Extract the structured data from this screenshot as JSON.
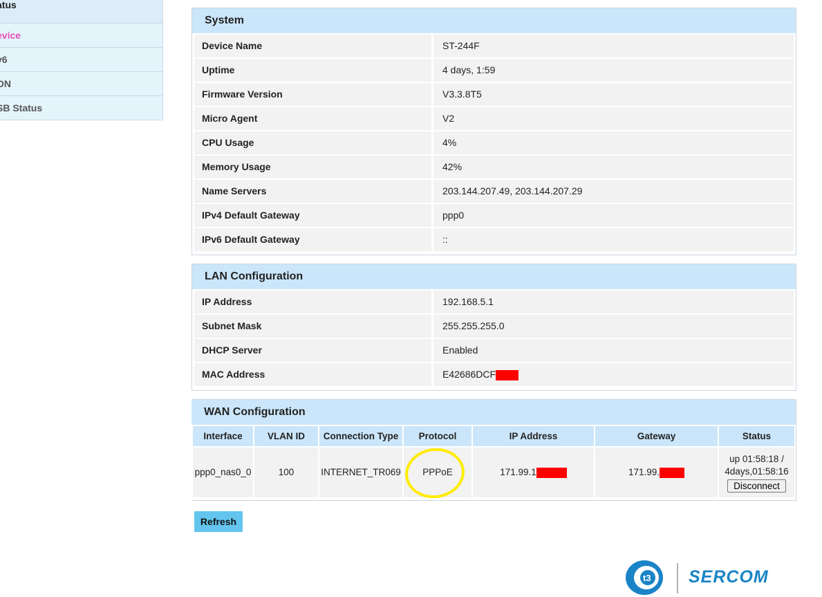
{
  "sidebar": {
    "header": "atus",
    "items": [
      {
        "label": "evice",
        "active": true
      },
      {
        "label": "v6",
        "active": false
      },
      {
        "label": "ON",
        "active": false
      },
      {
        "label": "SB Status",
        "active": false
      }
    ]
  },
  "system": {
    "title": "System",
    "rows": [
      {
        "key": "Device Name",
        "value": "ST-244F"
      },
      {
        "key": "Uptime",
        "value": "4 days, 1:59"
      },
      {
        "key": "Firmware Version",
        "value": "V3.3.8T5"
      },
      {
        "key": "Micro Agent",
        "value": "V2"
      },
      {
        "key": "CPU Usage",
        "value": "4%"
      },
      {
        "key": "Memory Usage",
        "value": "42%"
      },
      {
        "key": "Name Servers",
        "value": "203.144.207.49, 203.144.207.29"
      },
      {
        "key": "IPv4 Default Gateway",
        "value": "ppp0"
      },
      {
        "key": "IPv6 Default Gateway",
        "value": "::"
      }
    ]
  },
  "lan": {
    "title": "LAN Configuration",
    "rows": [
      {
        "key": "IP Address",
        "value": "192.168.5.1"
      },
      {
        "key": "Subnet Mask",
        "value": "255.255.255.0"
      },
      {
        "key": "DHCP Server",
        "value": "Enabled"
      },
      {
        "key": "MAC Address",
        "value": "E42686DCF"
      }
    ]
  },
  "wan": {
    "title": "WAN Configuration",
    "headers": [
      "Interface",
      "VLAN ID",
      "Connection Type",
      "Protocol",
      "IP Address",
      "Gateway",
      "Status"
    ],
    "row": {
      "interface": "ppp0_nas0_0",
      "vlan_id": "100",
      "connection_type": "INTERNET_TR069",
      "protocol": "PPPoE",
      "ip_address": "171.99.1",
      "gateway": "171.99.",
      "status_line1": "up 01:58:18 /",
      "status_line2": "4days,01:58:16",
      "disconnect_label": "Disconnect"
    }
  },
  "refresh_label": "Refresh",
  "brand": {
    "name": "SERCOM",
    "color": "#1a84c6"
  },
  "colors": {
    "header_bg": "#cbe6fa",
    "row_bg": "#f2f2f2",
    "active_nav": "#e84fb4",
    "redaction": "#ff0000",
    "annotation": "#ffec00"
  }
}
